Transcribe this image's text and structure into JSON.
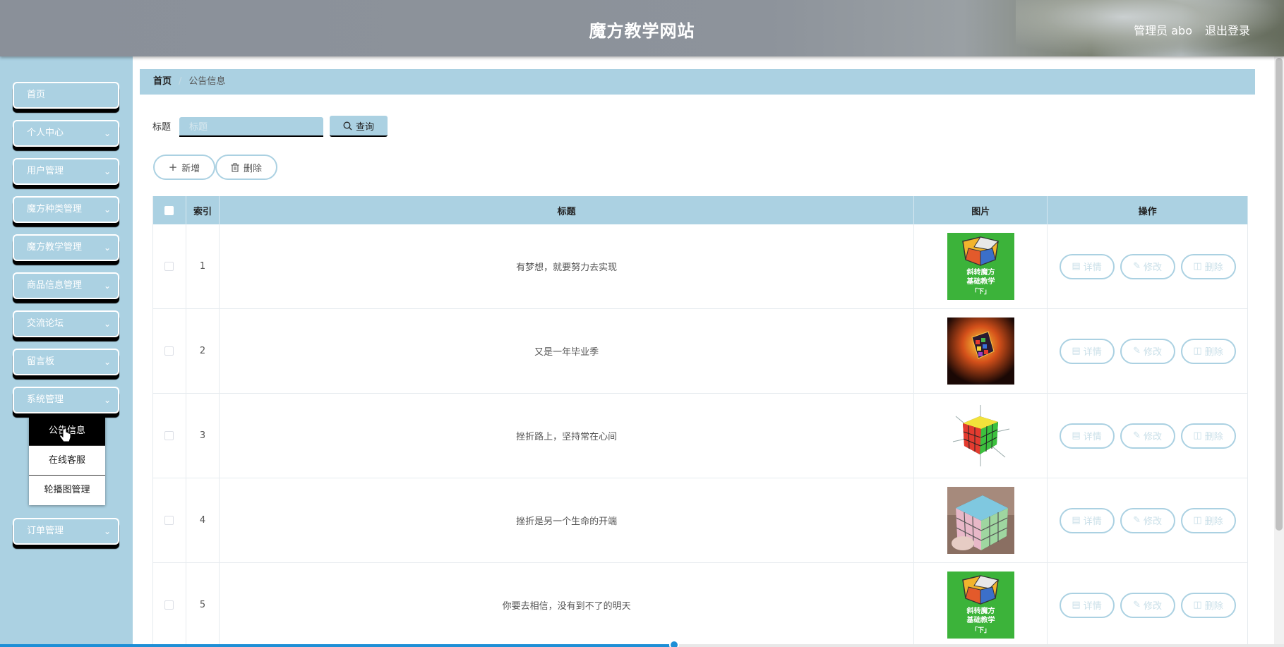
{
  "header": {
    "title": "魔方教学网站",
    "user": "管理员 abo",
    "logout": "退出登录"
  },
  "sidebar": {
    "items": [
      {
        "label": "首页",
        "has_chevron": false
      },
      {
        "label": "个人中心",
        "has_chevron": true
      },
      {
        "label": "用户管理",
        "has_chevron": true
      },
      {
        "label": "魔方种类管理",
        "has_chevron": true
      },
      {
        "label": "魔方教学管理",
        "has_chevron": true
      },
      {
        "label": "商品信息管理",
        "has_chevron": true
      },
      {
        "label": "交流论坛",
        "has_chevron": true
      },
      {
        "label": "留言板",
        "has_chevron": true
      },
      {
        "label": "系统管理",
        "has_chevron": true
      },
      {
        "label": "订单管理",
        "has_chevron": true
      }
    ],
    "submenu": [
      {
        "label": "公告信息",
        "active": true
      },
      {
        "label": "在线客服",
        "active": false
      },
      {
        "label": "轮播图管理",
        "active": false
      }
    ]
  },
  "breadcrumb": {
    "home": "首页",
    "separator": "/",
    "current": "公告信息"
  },
  "search": {
    "label": "标题",
    "placeholder": "标题",
    "button": "查询"
  },
  "actions": {
    "add": "新增",
    "delete": "删除"
  },
  "table": {
    "columns": [
      "索引",
      "标题",
      "图片",
      "操作"
    ],
    "rows": [
      {
        "index": "1",
        "title": "有梦想，就要努力去实现",
        "image": "green-cube-tutorial"
      },
      {
        "index": "2",
        "title": "又是一年毕业季",
        "image": "glowing-cube"
      },
      {
        "index": "3",
        "title": "挫折路上，坚持常在心间",
        "image": "cube-axes"
      },
      {
        "index": "4",
        "title": "挫折是另一个生命的开端",
        "image": "hand-cube"
      },
      {
        "index": "5",
        "title": "你要去相信，没有到不了的明天",
        "image": "green-cube-tutorial"
      }
    ],
    "ops": {
      "detail": "详情",
      "edit": "修改",
      "delete": "删除"
    },
    "thumb_text": [
      "斜转魔方",
      "基础教学",
      "「下」"
    ]
  },
  "colors": {
    "accent": "#abd1e2",
    "header": "#8a9099",
    "progress": "#1e8fd6"
  },
  "video_progress": 0.525
}
